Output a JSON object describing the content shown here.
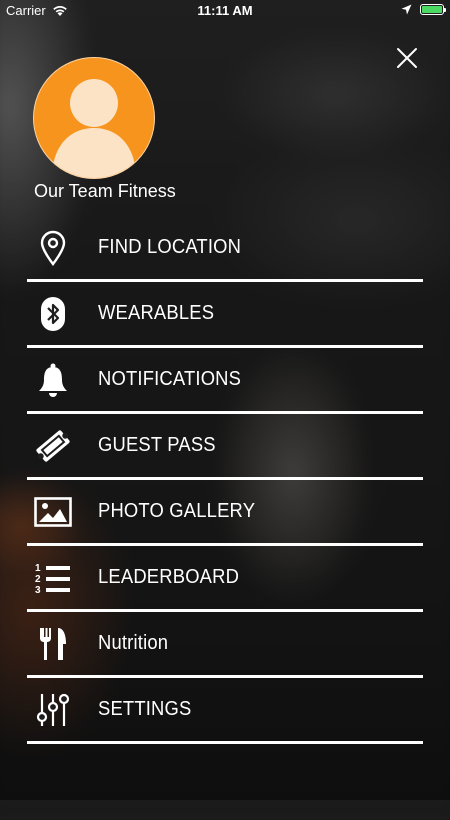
{
  "status_bar": {
    "carrier": "Carrier",
    "time": "11:11 AM"
  },
  "profile": {
    "name": "Our Team Fitness"
  },
  "menu": {
    "items": [
      {
        "label": "FIND LOCATION",
        "icon": "map-pin-icon"
      },
      {
        "label": "WEARABLES",
        "icon": "bluetooth-icon"
      },
      {
        "label": "NOTIFICATIONS",
        "icon": "bell-icon"
      },
      {
        "label": "GUEST PASS",
        "icon": "ticket-icon"
      },
      {
        "label": "PHOTO GALLERY",
        "icon": "image-icon"
      },
      {
        "label": "LEADERBOARD",
        "icon": "numbered-list-icon"
      },
      {
        "label": "Nutrition",
        "icon": "fork-knife-icon"
      },
      {
        "label": "SETTINGS",
        "icon": "sliders-icon"
      }
    ]
  },
  "colors": {
    "avatar_bg": "#f7941d",
    "avatar_figure": "#fde3c6",
    "battery": "#4cd964"
  }
}
